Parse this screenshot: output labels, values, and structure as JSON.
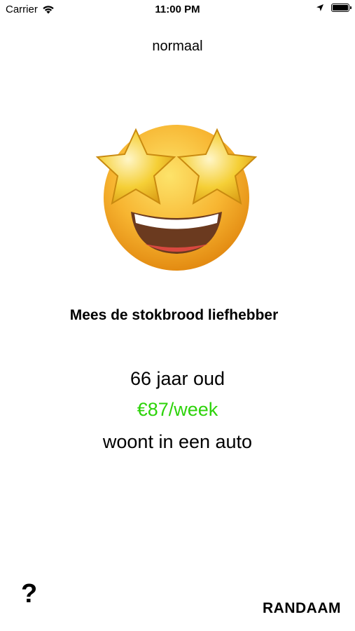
{
  "status_bar": {
    "carrier": "Carrier",
    "time": "11:00 PM",
    "battery_level": 1.0
  },
  "mode": "normaal",
  "emoji": {
    "icon": "star-struck-emoji",
    "face_color": "#f7b531",
    "star_color": "#f5cf36"
  },
  "profile": {
    "name": "Mees de stokbrood liefhebber",
    "age": "66 jaar oud",
    "price": "€87/week",
    "living": "woont in een auto"
  },
  "colors": {
    "price": "#2dd30a"
  },
  "footer": {
    "help_label": "?",
    "brand_label": "RANDAAM"
  }
}
